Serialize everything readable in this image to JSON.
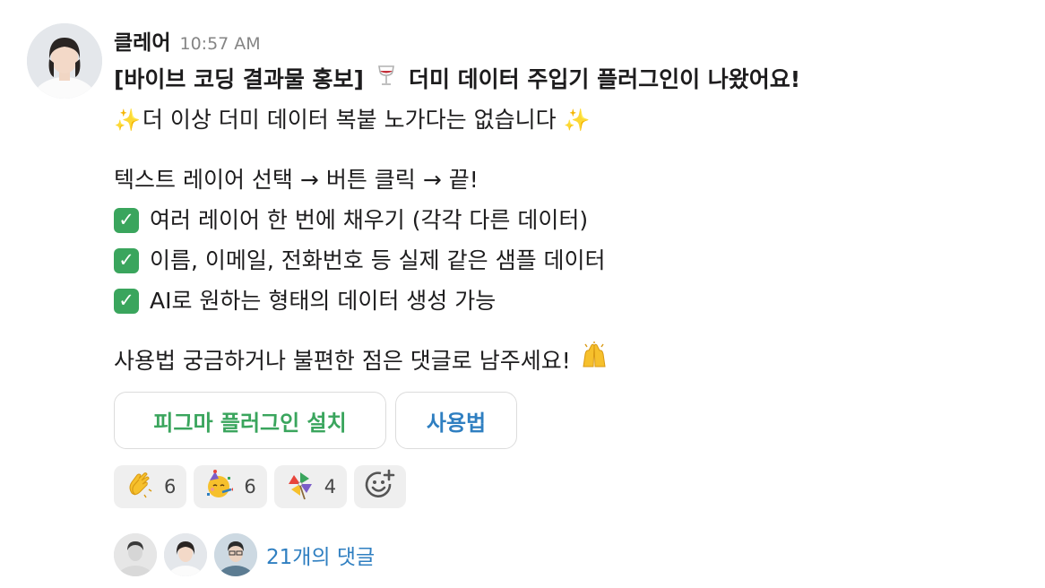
{
  "message": {
    "sender": "클레어",
    "timestamp": "10:57 AM",
    "title_prefix": "[바이브 코딩 결과물 홍보]",
    "title_suffix": "더미 데이터 주입기 플러그인이 나왔어요!",
    "subtitle": "더 이상 더미 데이터 복붙 노가다는 없습니다",
    "steps": {
      "step1": "텍스트 레이어 선택",
      "step2": "버튼 클릭",
      "step3": "끝!",
      "arrow": "→"
    },
    "features": [
      "여러 레이어 한 번에 채우기 (각각 다른 데이터)",
      "이름, 이메일, 전화번호 등 실제 같은 샘플 데이터",
      "AI로 원하는 형태의 데이터 생성 가능"
    ],
    "closing": "사용법 궁금하거나 불편한 점은 댓글로 남주세요!"
  },
  "buttons": {
    "install_label": "피그마 플러그인 설치",
    "howto_label": "사용법"
  },
  "reactions": [
    {
      "icon": "clapping-hands-icon",
      "count": "6"
    },
    {
      "icon": "party-face-icon",
      "count": "6"
    },
    {
      "icon": "pinwheel-icon",
      "count": "4"
    }
  ],
  "replies": {
    "label": "21개의 댓글"
  },
  "colors": {
    "accent_green": "#3aa55d",
    "link_blue": "#2f7fc1",
    "reaction_bg": "#efefef"
  }
}
